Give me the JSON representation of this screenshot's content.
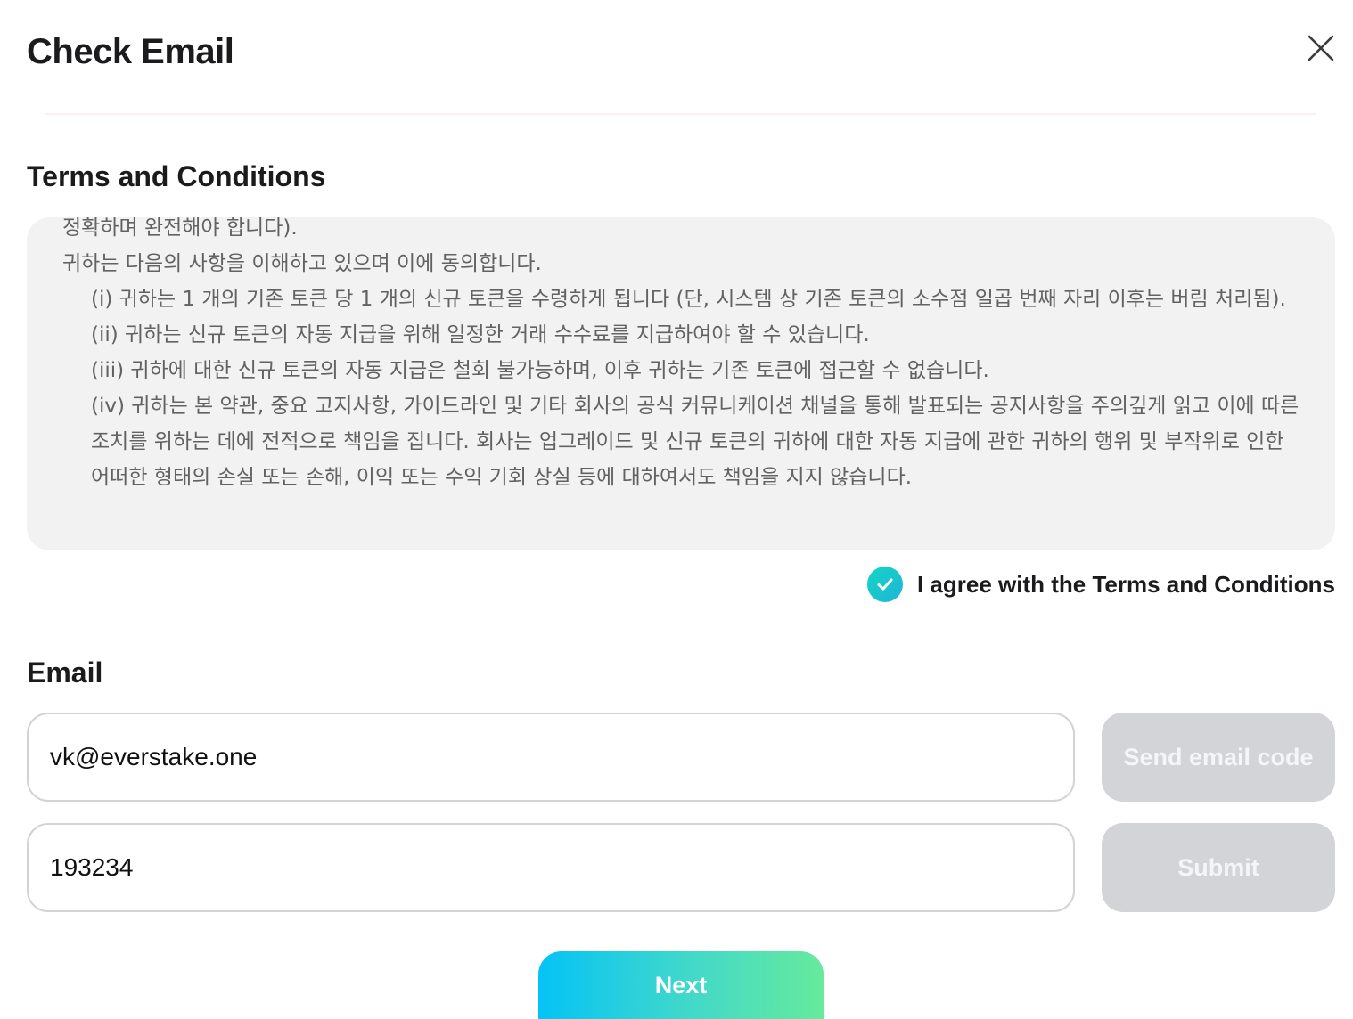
{
  "modal": {
    "title": "Check Email",
    "close_icon": "close-icon"
  },
  "terms": {
    "title": "Terms and Conditions",
    "paragraphs": [
      "정확하며 완전해야 합니다).",
      "귀하는 다음의 사항을 이해하고 있으며 이에 동의합니다.",
      "(i) 귀하는 1 개의 기존 토큰 당 1 개의 신규 토큰을 수령하게 됩니다 (단, 시스템 상 기존 토큰의 소수점 일곱 번째 자리 이후는 버림 처리됨).",
      "(ii) 귀하는 신규 토큰의 자동 지급을 위해 일정한 거래 수수료를 지급하여야 할 수 있습니다.",
      "(iii) 귀하에 대한 신규 토큰의 자동 지급은 철회 불가능하며, 이후 귀하는 기존 토큰에 접근할 수 없습니다.",
      "(iv) 귀하는 본 약관, 중요 고지사항, 가이드라인 및 기타 회사의 공식 커뮤니케이션 채널을 통해 발표되는 공지사항을 주의깊게 읽고 이에 따른 조치를 위하는 데에 전적으로 책임을 집니다. 회사는 업그레이드 및 신규 토큰의 귀하에 대한 자동 지급에 관한 귀하의 행위 및 부작위로 인한 어떠한 형태의 손실 또는 손해, 이익 또는 수익 기회 상실 등에 대하여서도 책임을 지지 않습니다."
    ],
    "agree_label": "I agree with the Terms and Conditions",
    "agree_checked": true,
    "check_icon": "checkmark-icon"
  },
  "email": {
    "title": "Email",
    "email_value": "vk@everstake.one",
    "code_value": "193234",
    "send_code_label": "Send email code",
    "submit_label": "Submit"
  },
  "footer": {
    "next_label": "Next"
  },
  "colors": {
    "accent_gradient_start": "#05c3f6",
    "accent_gradient_end": "#66ea9c",
    "disabled_button": "#d2d4d8",
    "terms_background": "#f2f2f2"
  }
}
